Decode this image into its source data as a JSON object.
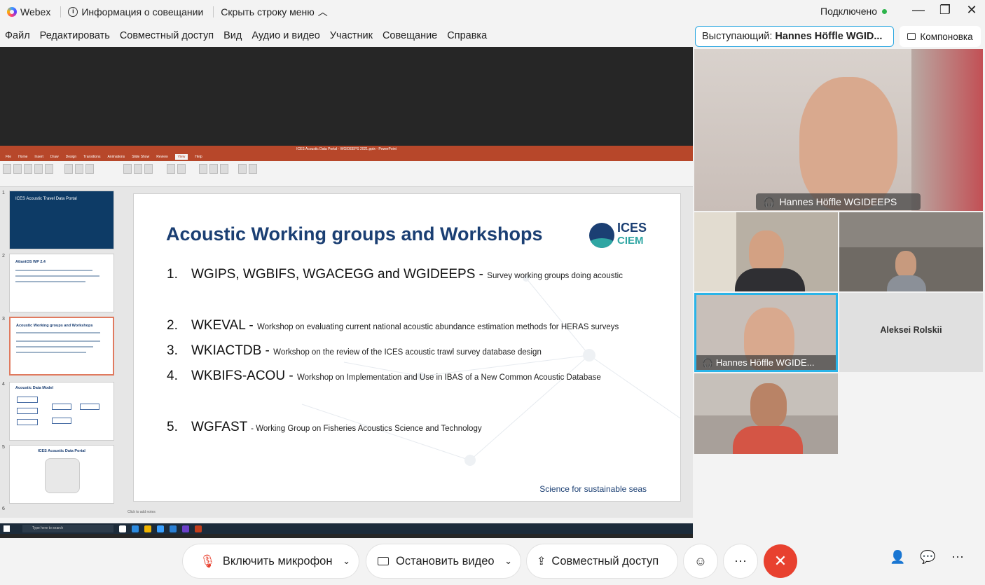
{
  "titlebar": {
    "app": "Webex",
    "meeting_info": "Информация о совещании",
    "hide_menu": "Скрыть строку меню",
    "status": "Подключено"
  },
  "menu": [
    "Файл",
    "Редактировать",
    "Совместный доступ",
    "Вид",
    "Аудио и видео",
    "Участник",
    "Совещание",
    "Справка"
  ],
  "speaker": {
    "prefix": "Выступающий:",
    "name": "Hannes Höffle WGID..."
  },
  "layout_label": "Компоновка",
  "shared": {
    "window_title": "ICES Acoustic Data Portal - WGIDEEPS 2021.pptx - PowerPoint",
    "tabs": [
      "File",
      "Home",
      "Insert",
      "Draw",
      "Design",
      "Transitions",
      "Animations",
      "Slide Show",
      "Review",
      "View",
      "Help"
    ],
    "active_tab": "View",
    "notes_hint": "Click to add notes",
    "search_hint": "Type here to search",
    "slide": {
      "title": "Acoustic Working groups and Workshops",
      "logo_top": "ICES",
      "logo_bottom": "CIEM",
      "items": [
        {
          "num": "1.",
          "name": "WGIPS, WGBIFS, WGACEGG and WGIDEEPS -",
          "desc": "Survey working groups doing acoustic"
        },
        {
          "num": "2.",
          "name": "WKEVAL -",
          "desc": "Workshop on evaluating current national acoustic abundance estimation methods for HERAS surveys"
        },
        {
          "num": "3.",
          "name": "WKIACTDB -",
          "desc": "Workshop on the review of the ICES acoustic trawl survey database design"
        },
        {
          "num": "4.",
          "name": "WKBIFS-ACOU -",
          "desc": "Workshop on Implementation and Use in IBAS of a New Common Acoustic Database"
        },
        {
          "num": "5.",
          "name": "WGFAST",
          "desc": "- Working Group on Fisheries Acoustics Science and Technology"
        }
      ],
      "tagline": "Science for sustainable seas"
    },
    "thumbs": [
      {
        "n": "1",
        "title": "ICES Acoustic Travel Data Portal"
      },
      {
        "n": "2",
        "title": "AtlantOS WP 2.4"
      },
      {
        "n": "3",
        "title": "Acoustic Working groups and Workshops"
      },
      {
        "n": "4",
        "title": "Acoustic Data Model"
      },
      {
        "n": "5",
        "title": "ICES Acoustic Data Portal"
      },
      {
        "n": "6",
        "title": ""
      }
    ]
  },
  "participants": {
    "main_name": "Hannes Höffle WGIDEEPS",
    "self_name": "Hannes Höffle WGIDE...",
    "no_video_name": "Aleksei Rolskii"
  },
  "controls": {
    "mic": "Включить микрофон",
    "video": "Остановить видео",
    "share": "Совместный доступ"
  },
  "colors": {
    "accent": "#2aa6e0",
    "end_call": "#e8412f",
    "connected": "#2db44b"
  }
}
